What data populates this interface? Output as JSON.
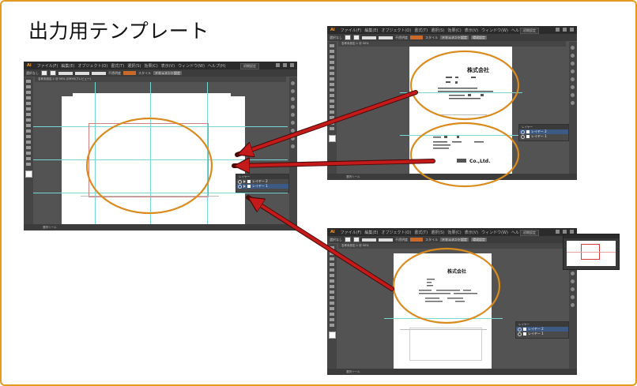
{
  "slide": {
    "title": "出力用テンプレート",
    "border_color": "#e39a1e"
  },
  "app_windows": [
    {
      "id": "main",
      "logo": "Ai",
      "menu_items": [
        "ファイル(F)",
        "編集(E)",
        "オブジェクト(O)",
        "書式(T)",
        "選択(S)",
        "効果(C)",
        "表示(V)",
        "ウィンドウ(W)",
        "ヘルプ(H)"
      ],
      "workspace": "初期設定",
      "control_bar": {
        "label": "選択なし",
        "opacity_label": "不透明度",
        "style_label": "スタイル",
        "doc_setup_button": "ドキュメント設定"
      },
      "tab_title": "名称未設定-1 @ 50% (CMYK/プレビュー)",
      "status_text": "選択ツール",
      "layers": [
        "レイヤー 2",
        "レイヤー 1"
      ],
      "layers_header": "レイヤー"
    },
    {
      "id": "top-right",
      "logo": "Ai",
      "menu_items": [
        "ファイル(F)",
        "編集(E)",
        "オブジェクト(O)",
        "書式(T)",
        "選択(S)",
        "効果(C)",
        "表示(V)",
        "ウィンドウ(W)",
        "ヘルプ(H)"
      ],
      "workspace": "初期設定",
      "control_bar": {
        "label": "選択なし",
        "opacity_label": "不透明度",
        "style_label": "スタイル",
        "doc_setup_button": "ドキュメント設定",
        "prefs_button": "環境設定"
      },
      "tab_title": "名称未設定-1 @ 50%",
      "status_text": "選択ツール",
      "layers": [
        "レイヤー 2",
        "レイヤー 1"
      ],
      "layers_header": "レイヤー",
      "doc": {
        "company": "株式会社",
        "company_en": "Co.,Ltd."
      }
    },
    {
      "id": "bottom-right",
      "logo": "Ai",
      "menu_items": [
        "ファイル(F)",
        "編集(E)",
        "オブジェクト(O)",
        "書式(T)",
        "選択(S)",
        "効果(C)",
        "表示(V)",
        "ウィンドウ(W)",
        "ヘルプ(H)"
      ],
      "workspace": "初期設定",
      "control_bar": {
        "label": "選択なし",
        "opacity_label": "不透明度",
        "style_label": "スタイル",
        "doc_setup_button": "ドキュメント設定",
        "prefs_button": "環境設定"
      },
      "tab_title": "名称未設定-1 @ 50%",
      "status_text": "選択ツール",
      "layers": [
        "レイヤー 2",
        "レイヤー 1"
      ],
      "layers_header": "レイヤー",
      "doc": {
        "company": "株式会社"
      }
    }
  ],
  "annotations": {
    "ellipse_color": "#d98b1e",
    "arrow_color": "#c41a1a"
  }
}
